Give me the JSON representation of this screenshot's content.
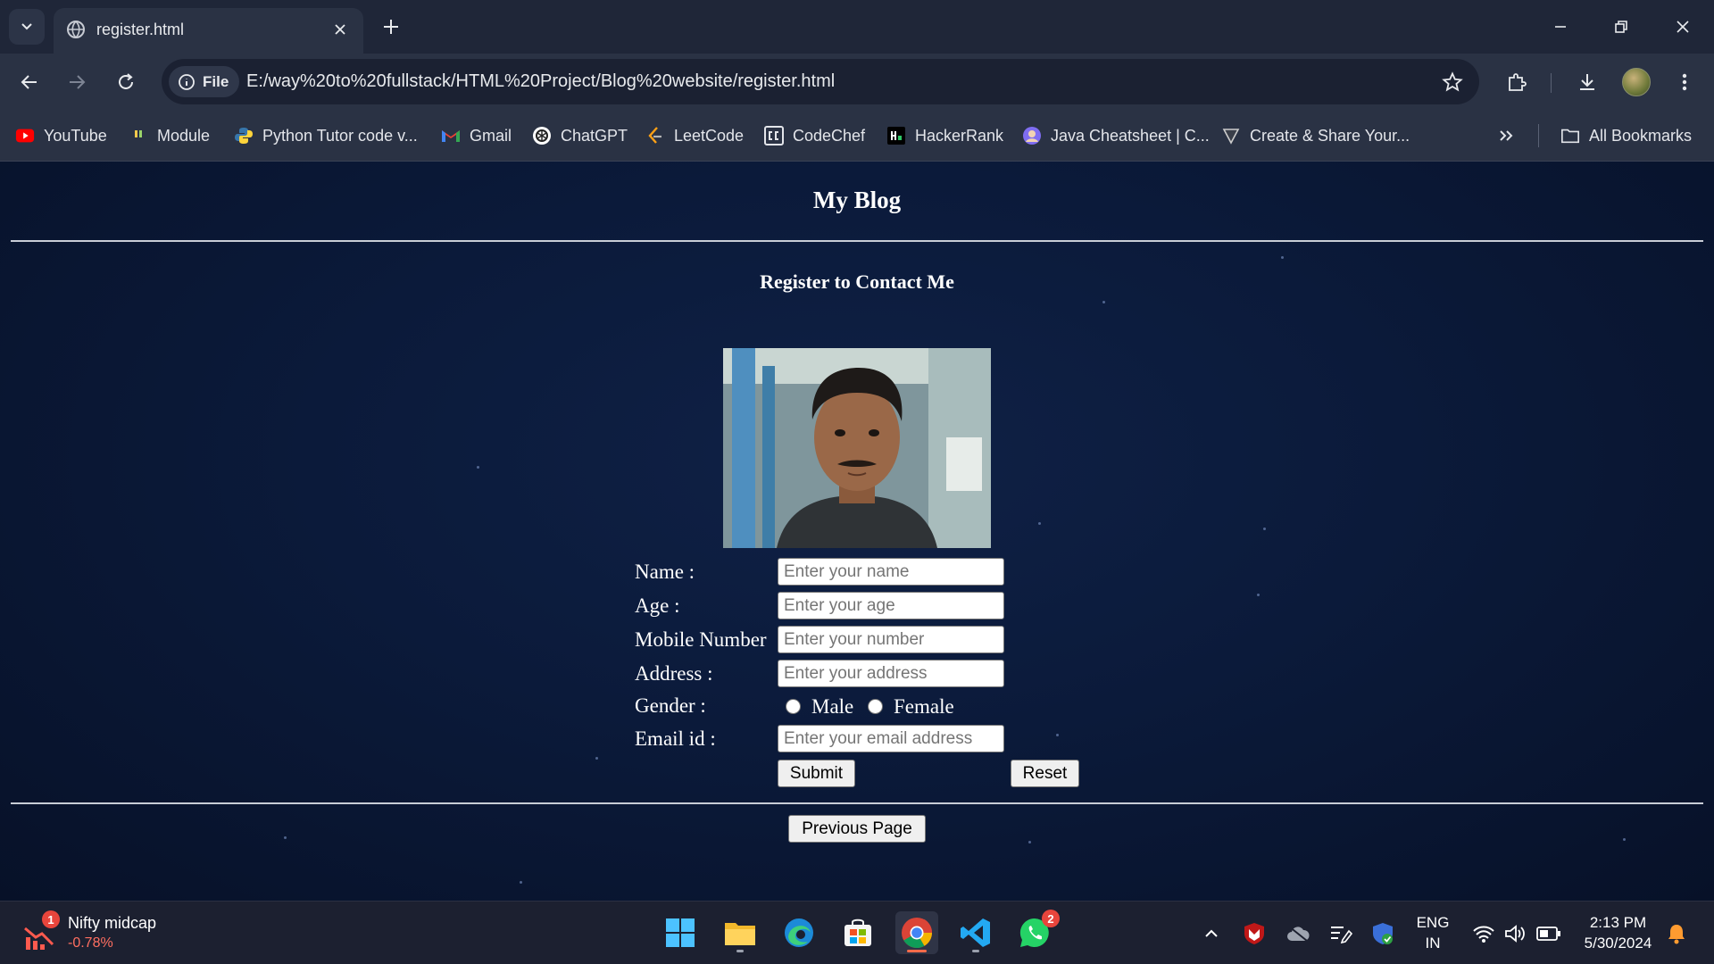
{
  "browser": {
    "tab_title": "register.html",
    "url_chip_label": "File",
    "url": "E:/way%20to%20fullstack/HTML%20Project/Blog%20website/register.html"
  },
  "bookmarks": [
    {
      "label": "YouTube",
      "icon": "youtube-icon",
      "color": "#ff0000"
    },
    {
      "label": "Module",
      "icon": "module-icon",
      "color": "#f2c94c"
    },
    {
      "label": "Python Tutor code v...",
      "icon": "python-icon",
      "color": "#3776ab"
    },
    {
      "label": "Gmail",
      "icon": "gmail-icon",
      "color": "#ea4335"
    },
    {
      "label": "ChatGPT",
      "icon": "chatgpt-icon",
      "color": "#ffffff"
    },
    {
      "label": "LeetCode",
      "icon": "leetcode-icon",
      "color": "#ffa116"
    },
    {
      "label": "CodeChef",
      "icon": "codechef-icon",
      "color": "#ffffff"
    },
    {
      "label": "HackerRank",
      "icon": "hackerrank-icon",
      "color": "#2ec866"
    },
    {
      "label": "Java Cheatsheet | C...",
      "icon": "java-cheatsheet-icon",
      "color": "#9b8cff"
    },
    {
      "label": "Create & Share Your...",
      "icon": "create-share-icon",
      "color": "#cccccc"
    }
  ],
  "all_bookmarks_label": "All Bookmarks",
  "page": {
    "title": "My Blog",
    "subtitle": "Register to Contact Me",
    "form": {
      "name_label": "Name :",
      "name_placeholder": "Enter your name",
      "age_label": "Age :",
      "age_placeholder": "Enter your age",
      "mobile_label": "Mobile Number",
      "mobile_placeholder": "Enter your number",
      "address_label": "Address :",
      "address_placeholder": "Enter your address",
      "gender_label": "Gender :",
      "gender_options": [
        "Male",
        "Female"
      ],
      "email_label": "Email id :",
      "email_placeholder": "Enter your email address",
      "submit_label": "Submit",
      "reset_label": "Reset"
    },
    "previous_page_label": "Previous Page"
  },
  "taskbar": {
    "widget_title": "Nifty midcap",
    "widget_value": "-0.78%",
    "widget_badge": "1",
    "whatsapp_badge": "2",
    "language_line1": "ENG",
    "language_line2": "IN",
    "time": "2:13 PM",
    "date": "5/30/2024"
  }
}
